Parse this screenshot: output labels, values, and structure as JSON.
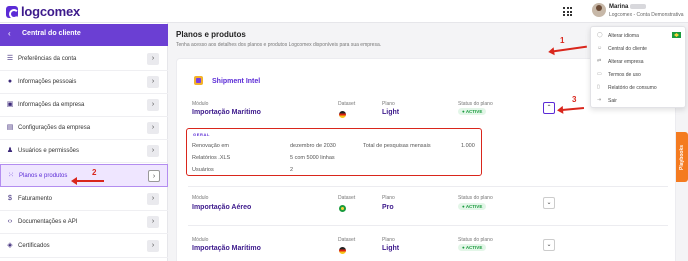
{
  "header": {
    "logo_text": "logcomex",
    "user_name": "Marina",
    "user_org": "Logcomex - Conta Demonstrativa"
  },
  "sidebar": {
    "title": "Central do cliente",
    "back_icon": "chevron-left-icon",
    "items": [
      {
        "label": "Preferências da conta",
        "icon": "sliders-icon"
      },
      {
        "label": "Informações pessoais",
        "icon": "user-icon"
      },
      {
        "label": "Informações da empresa",
        "icon": "briefcase-icon"
      },
      {
        "label": "Configurações da empresa",
        "icon": "building-icon"
      },
      {
        "label": "Usuários e permissões",
        "icon": "users-icon"
      },
      {
        "label": "Planos e produtos",
        "icon": "grid-icon",
        "active": true
      },
      {
        "label": "Faturamento",
        "icon": "dollar-icon"
      },
      {
        "label": "Documentações e API",
        "icon": "code-icon"
      },
      {
        "label": "Certificados",
        "icon": "shield-icon"
      }
    ]
  },
  "main": {
    "title": "Planos e produtos",
    "subtitle": "Tenha acesso aos detalhes dos planos e produtos Logcomex disponíveis para sua empresa.",
    "product_name": "Shipment Intel",
    "labels": {
      "modulo": "Módulo",
      "dataset": "Dataset",
      "plano": "Plano",
      "status": "Status do plano"
    },
    "rows": [
      {
        "modulo": "Importação Marítimo",
        "dataset_flag": "germany-flag",
        "plano": "Light",
        "status": "ACTIVE"
      },
      {
        "modulo": "Importação Aéreo",
        "dataset_flag": "brazil-flag",
        "plano": "Pro",
        "status": "ACTIVE"
      },
      {
        "modulo": "Importação Marítimo",
        "dataset_flag": "germany-flag",
        "plano": "Light",
        "status": "ACTIVE"
      }
    ],
    "detail": {
      "section": "GERAL",
      "renovacao_label": "Renovação em",
      "renovacao_value": "dezembro de 2030",
      "pesquisas_label": "Total de pesquisas mensais",
      "pesquisas_value": "1.000",
      "relatorios_label": "Relatórios .XLS",
      "relatorios_value": "5 com 5000 linhas",
      "usuarios_label": "Usuários",
      "usuarios_value": "2"
    }
  },
  "dropdown": {
    "items": [
      {
        "label": "Alterar idioma",
        "icon": "globe-icon"
      },
      {
        "label": "Central do cliente",
        "icon": "person-icon"
      },
      {
        "label": "Alterar empresa",
        "icon": "swap-icon"
      },
      {
        "label": "Termos de uso",
        "icon": "document-icon"
      },
      {
        "label": "Relatório de consumo",
        "icon": "report-icon"
      },
      {
        "label": "Sair",
        "icon": "logout-icon"
      }
    ]
  },
  "playbooks_label": "Playbooks",
  "annotations": [
    "1",
    "2",
    "3"
  ],
  "colors": {
    "brand": "#5b2bd6",
    "annotation": "#d9261c",
    "active_status": "#1a9b3e",
    "playbooks": "#f47b20"
  }
}
